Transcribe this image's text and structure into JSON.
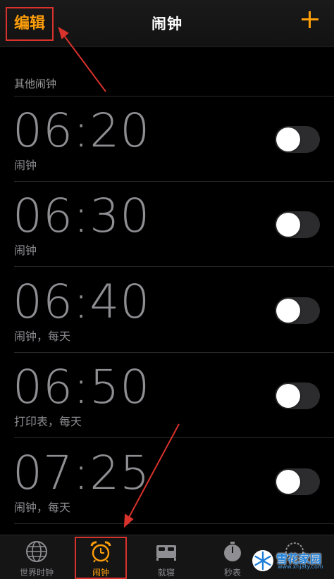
{
  "navbar": {
    "edit_label": "编辑",
    "title": "闹钟",
    "add_icon": "plus-icon"
  },
  "section": {
    "header": "其他闹钟"
  },
  "alarms": [
    {
      "time": "06:20",
      "label": "闹钟",
      "enabled": false
    },
    {
      "time": "06:30",
      "label": "闹钟",
      "enabled": false
    },
    {
      "time": "06:40",
      "label": "闹钟，每天",
      "enabled": false
    },
    {
      "time": "06:50",
      "label": "打印表，每天",
      "enabled": false
    },
    {
      "time": "07:25",
      "label": "闹钟，每天",
      "enabled": false
    }
  ],
  "tabbar": {
    "tabs": [
      {
        "label": "世界时钟",
        "icon": "globe-icon",
        "active": false
      },
      {
        "label": "闹钟",
        "icon": "alarm-clock-icon",
        "active": true
      },
      {
        "label": "就寝",
        "icon": "bed-icon",
        "active": false
      },
      {
        "label": "秒表",
        "icon": "stopwatch-icon",
        "active": false
      },
      {
        "label": "",
        "icon": "timer-icon",
        "active": false
      }
    ]
  },
  "watermark": {
    "text": "雪花家园",
    "url": "www.xhjaty.com"
  },
  "colors": {
    "accent": "#ff9f0a",
    "annotation": "#d8322c",
    "secondary_text": "#8e8e93",
    "toggle_off": "#2c2c2e"
  }
}
